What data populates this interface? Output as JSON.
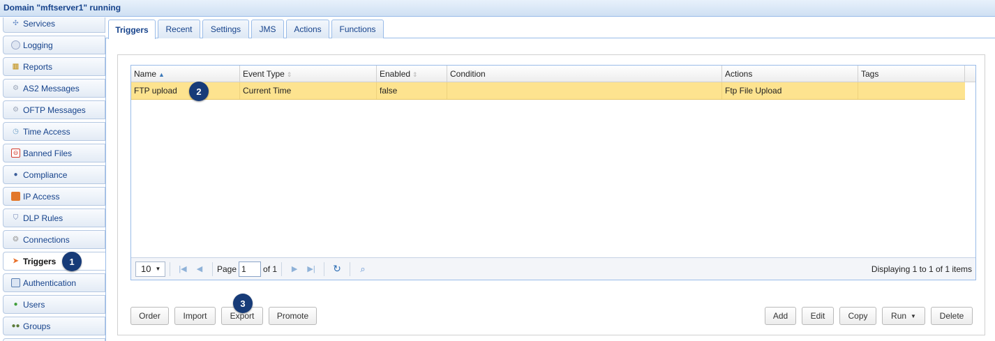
{
  "window": {
    "title": "Domain \"mftserver1\" running"
  },
  "sidebar": {
    "items": [
      {
        "label": "Services",
        "icon": "services-icon",
        "color": "#6a8ec8"
      },
      {
        "label": "Logging",
        "icon": "logging-icon",
        "color": "#9aa9c9"
      },
      {
        "label": "Reports",
        "icon": "reports-icon",
        "color": "#c79a2c"
      },
      {
        "label": "AS2 Messages",
        "icon": "as2-messages-icon",
        "color": "#9ca6b8"
      },
      {
        "label": "OFTP Messages",
        "icon": "oftp-messages-icon",
        "color": "#9ca6b8"
      },
      {
        "label": "Time Access",
        "icon": "time-access-icon",
        "color": "#6fa0c8"
      },
      {
        "label": "Banned Files",
        "icon": "banned-files-icon",
        "color": "#d43b2b"
      },
      {
        "label": "Compliance",
        "icon": "compliance-icon",
        "color": "#3a5d9a"
      },
      {
        "label": "IP Access",
        "icon": "ip-access-icon",
        "color": "#e2782b"
      },
      {
        "label": "DLP Rules",
        "icon": "dlp-rules-icon",
        "color": "#6b7fb0"
      },
      {
        "label": "Connections",
        "icon": "connections-icon",
        "color": "#a3a3a3"
      },
      {
        "label": "Triggers",
        "icon": "triggers-icon",
        "color": "#e8702a"
      },
      {
        "label": "Authentication",
        "icon": "authentication-icon",
        "color": "#5a7fb3"
      },
      {
        "label": "Users",
        "icon": "users-icon",
        "color": "#3f9e3a"
      },
      {
        "label": "Groups",
        "icon": "groups-icon",
        "color": "#5b7b3a"
      }
    ]
  },
  "tabs": [
    {
      "label": "Triggers"
    },
    {
      "label": "Recent"
    },
    {
      "label": "Settings"
    },
    {
      "label": "JMS"
    },
    {
      "label": "Actions"
    },
    {
      "label": "Functions"
    }
  ],
  "grid": {
    "columns": [
      "Name",
      "Event Type",
      "Enabled",
      "Condition",
      "Actions",
      "Tags"
    ],
    "rows": [
      {
        "name": "FTP upload",
        "event_type": "Current Time",
        "enabled": "false",
        "condition": "",
        "actions": "Ftp File Upload",
        "tags": ""
      }
    ],
    "pager": {
      "page_size": "10",
      "page_label": "Page",
      "page_value": "1",
      "of_label": "of 1",
      "info": "Displaying 1 to 1 of 1 items"
    }
  },
  "buttons": {
    "order": "Order",
    "import": "Import",
    "export": "Export",
    "promote": "Promote",
    "add": "Add",
    "edit": "Edit",
    "copy": "Copy",
    "run": "Run",
    "delete": "Delete"
  },
  "markers": [
    "1",
    "2",
    "3"
  ],
  "colors": {
    "selected_row": "#fde38f",
    "accent": "#15428b",
    "marker": "#173b78"
  }
}
